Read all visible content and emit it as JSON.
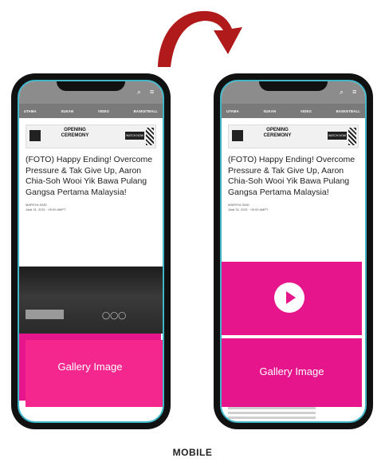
{
  "caption": "MOBILE",
  "nav_items": [
    "UTAMA",
    "SUKAN",
    "VIDEO",
    "BASKETBALL"
  ],
  "banner": {
    "title_top": "OPENING",
    "title_bottom": "CEREMONY",
    "cta": "WATCH NOW"
  },
  "article": {
    "headline": "(FOTO) Happy Ending! Overcome Pressure & Tak Give Up, Aaron Chia-Soh Wooi Yik Bawa Pulang Gangsa Pertama Malaysia!",
    "author": "MARSYA SAID",
    "date": "Julai 31, 2021 · 09:00 AMPT"
  },
  "gallery_label": "Gallery Image",
  "colors": {
    "accent": "#e6158c",
    "phone_frame": "#111111",
    "topbar": "#8c8c8c",
    "arrow": "#b01a1a"
  },
  "icons": [
    "search-icon",
    "menu-icon",
    "play-icon"
  ]
}
